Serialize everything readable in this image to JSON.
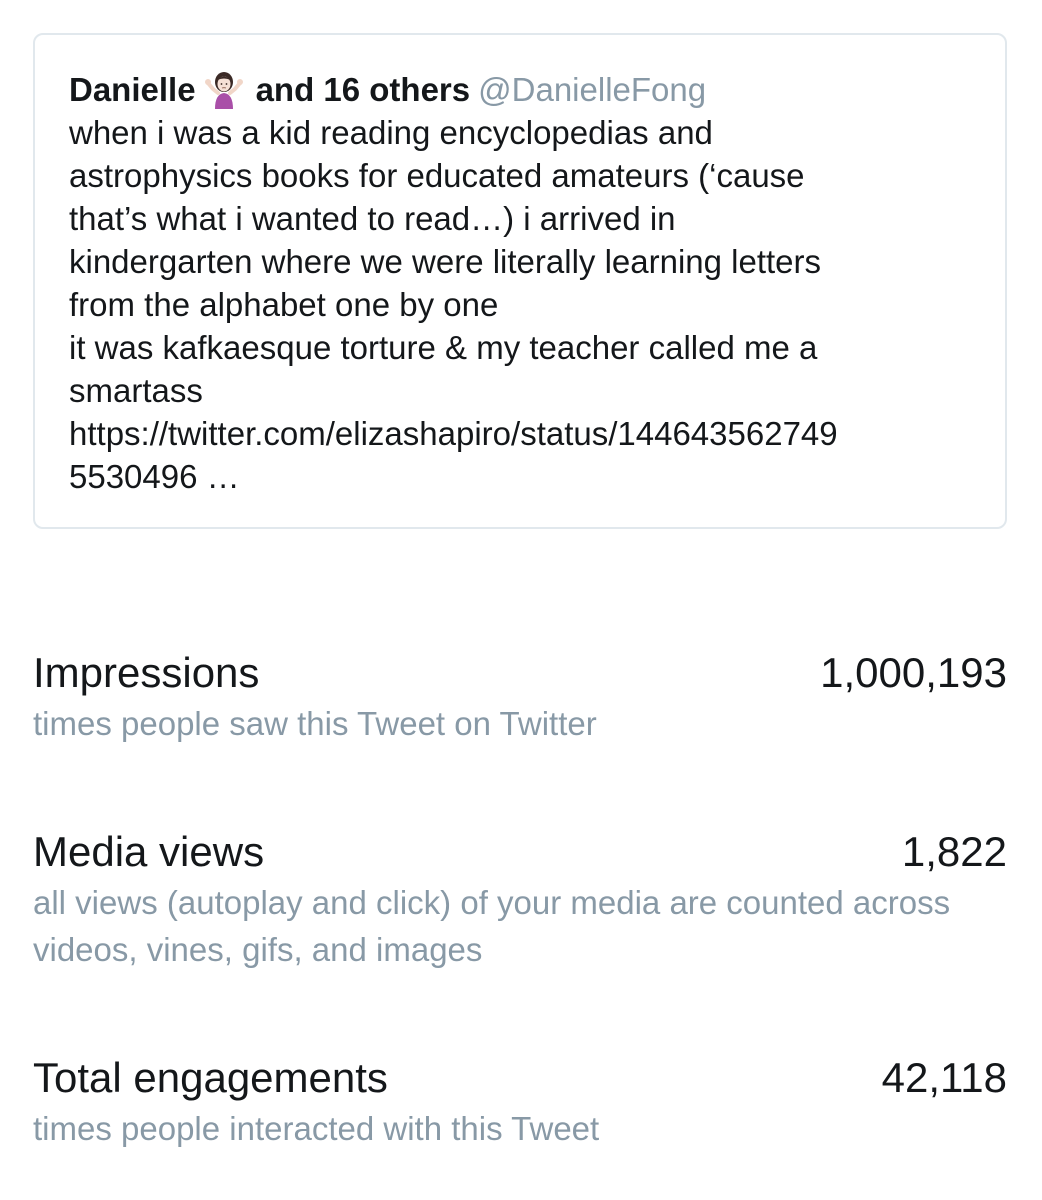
{
  "tweet": {
    "author_name": "Danielle",
    "emoji": "person-shrugging-emoji",
    "author_others": "and 16 others",
    "handle": "@DanielleFong",
    "text": "when i was a kid reading encyclopedias and\nastrophysics books for educated amateurs (‘cause\nthat’s what i wanted to read…) i arrived in\nkindergarten where we were literally learning letters\nfrom the alphabet one by one\nit was kafkaesque torture & my teacher called me a\nsmartass\nhttps://twitter.com/elizashapiro/status/144643562749\n5530496 …"
  },
  "metrics": [
    {
      "title": "Impressions",
      "value": "1,000,193",
      "description": "times people saw this Tweet on Twitter"
    },
    {
      "title": "Media views",
      "value": "1,822",
      "description": "all views (autoplay and click) of your media are counted across videos, vines, gifs, and images"
    },
    {
      "title": "Total engagements",
      "value": "42,118",
      "description": "times people interacted with this Tweet"
    }
  ],
  "colors": {
    "primary_text": "#14171a",
    "secondary_text": "#8899a6",
    "card_border": "#e1e8ed"
  }
}
